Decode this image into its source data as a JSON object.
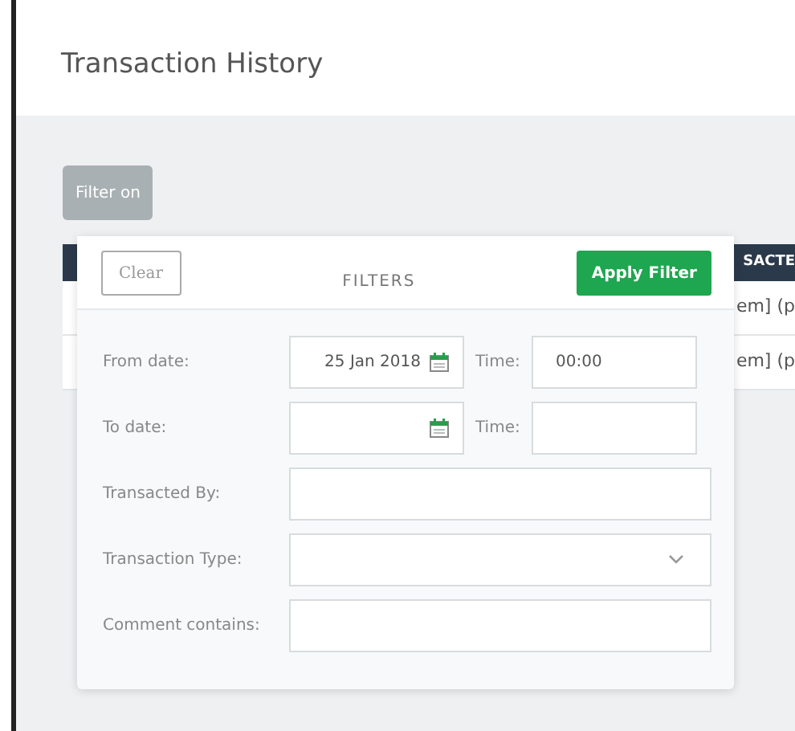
{
  "page_title": "Transaction History",
  "filter_button": {
    "label": "Filter on",
    "on": true
  },
  "table": {
    "visible_header": "SACTE",
    "visible_rows": [
      "em] (p",
      "em] (p"
    ]
  },
  "filters": {
    "title": "FILTERS",
    "clear_label": "Clear",
    "apply_label": "Apply Filter",
    "fields": [
      {
        "kind": "datetime",
        "label": "From date:",
        "value": "25 Jan 2018",
        "time_label": "Time:",
        "time_value": "00:00"
      },
      {
        "kind": "datetime",
        "label": "To date:",
        "time_label": "Time:"
      },
      {
        "kind": "text",
        "label": "Transacted By:"
      },
      {
        "kind": "select",
        "label": "Transaction Type:"
      },
      {
        "kind": "text",
        "label": "Comment contains:"
      }
    ]
  }
}
